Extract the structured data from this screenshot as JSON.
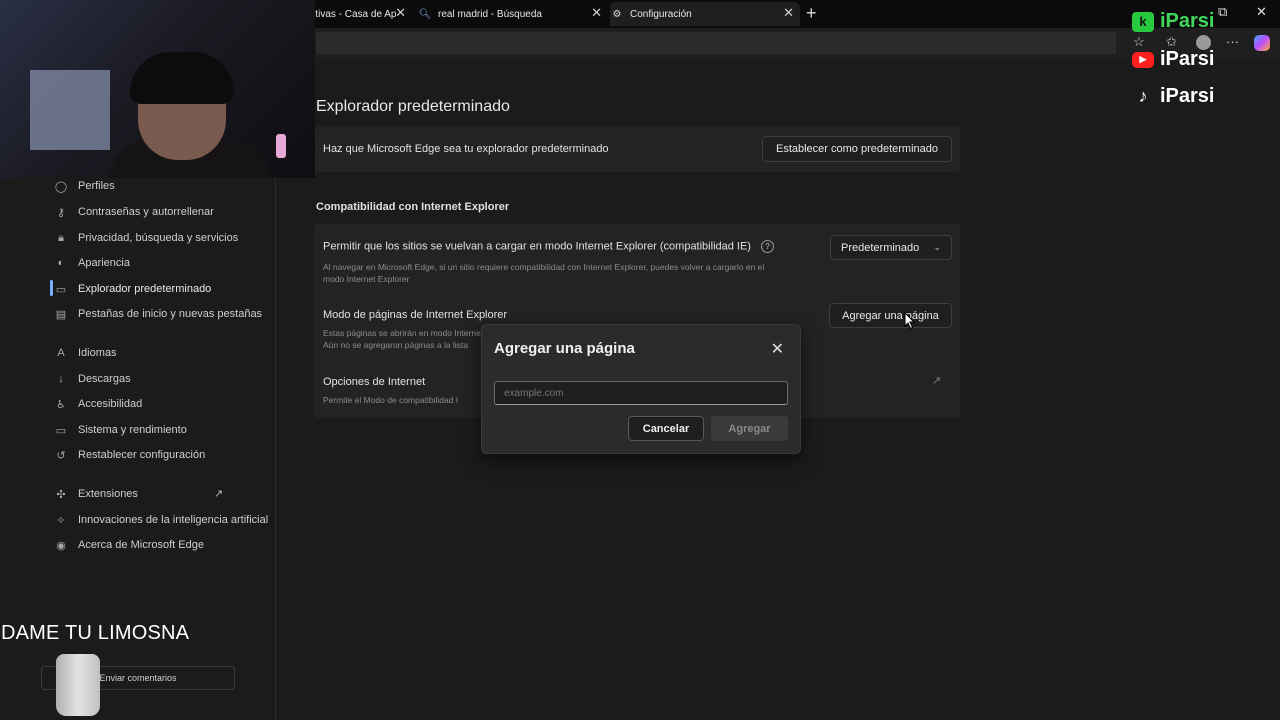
{
  "tabs": [
    {
      "title": "rtivas - Casa de Ap",
      "icon": "edge-tab-icon"
    },
    {
      "title": "real madrid - Búsqueda",
      "icon": "search-icon"
    },
    {
      "title": "Configuración",
      "icon": "gear-icon"
    }
  ],
  "sidebar": {
    "items": [
      {
        "label": "Perfiles",
        "icon": "profile-icon"
      },
      {
        "label": "Contraseñas y autorrellenar",
        "icon": "key-icon"
      },
      {
        "label": "Privacidad, búsqueda y servicios",
        "icon": "lock-icon"
      },
      {
        "label": "Apariencia",
        "icon": "appearance-icon"
      },
      {
        "label": "Explorador predeterminado",
        "icon": "browser-icon"
      },
      {
        "label": "Pestañas de inicio y nuevas pestañas",
        "icon": "tabs-icon"
      },
      {
        "label": "Idiomas",
        "icon": "language-icon"
      },
      {
        "label": "Descargas",
        "icon": "download-icon"
      },
      {
        "label": "Accesibilidad",
        "icon": "accessibility-icon"
      },
      {
        "label": "Sistema y rendimiento",
        "icon": "system-icon"
      },
      {
        "label": "Restablecer configuración",
        "icon": "reset-icon"
      },
      {
        "label": "Extensiones",
        "icon": "extension-icon"
      },
      {
        "label": "Innovaciones de la inteligencia artificial",
        "icon": "ai-icon"
      },
      {
        "label": "Acerca de Microsoft Edge",
        "icon": "edge-icon"
      }
    ],
    "active": "Explorador predeterminado",
    "feedback_label": "Enviar comentarios"
  },
  "main": {
    "title": "Explorador predeterminado",
    "default_row_label": "Haz que Microsoft Edge sea tu explorador predeterminado",
    "default_button": "Establecer como predeterminado",
    "ie_section_title": "Compatibilidad con Internet Explorer",
    "ie_reload_label": "Permitir que los sitios se vuelvan a cargar en modo Internet Explorer (compatibilidad IE)",
    "ie_reload_desc_1": "Al navegar en Microsoft Edge, si un sitio requiere compatibilidad con Internet Explorer, puedes volver a cargarlo en el",
    "ie_reload_desc_2": "modo Internet Explorer",
    "ie_reload_select": "Predeterminado",
    "ie_pages_label": "Modo de páginas de Internet Explorer",
    "ie_pages_desc_1": "Estas páginas se abrirán en modo Internet",
    "ie_pages_desc_2": "Aún no se agregaron páginas a la lista",
    "ie_pages_button": "Agregar una página",
    "internet_options_label": "Opciones de Internet",
    "internet_options_desc": "Permite el Modo de compatibilidad I"
  },
  "dialog": {
    "title": "Agregar una página",
    "input_placeholder": "example.com",
    "cancel_label": "Cancelar",
    "add_label": "Agregar"
  },
  "overlay": {
    "brand_name": "iParsi",
    "donation_text": "DAME TU LIMOSNA"
  },
  "colors": {
    "accent": "#7ab0ff",
    "background": "#1b1b1b",
    "card": "#232323"
  }
}
